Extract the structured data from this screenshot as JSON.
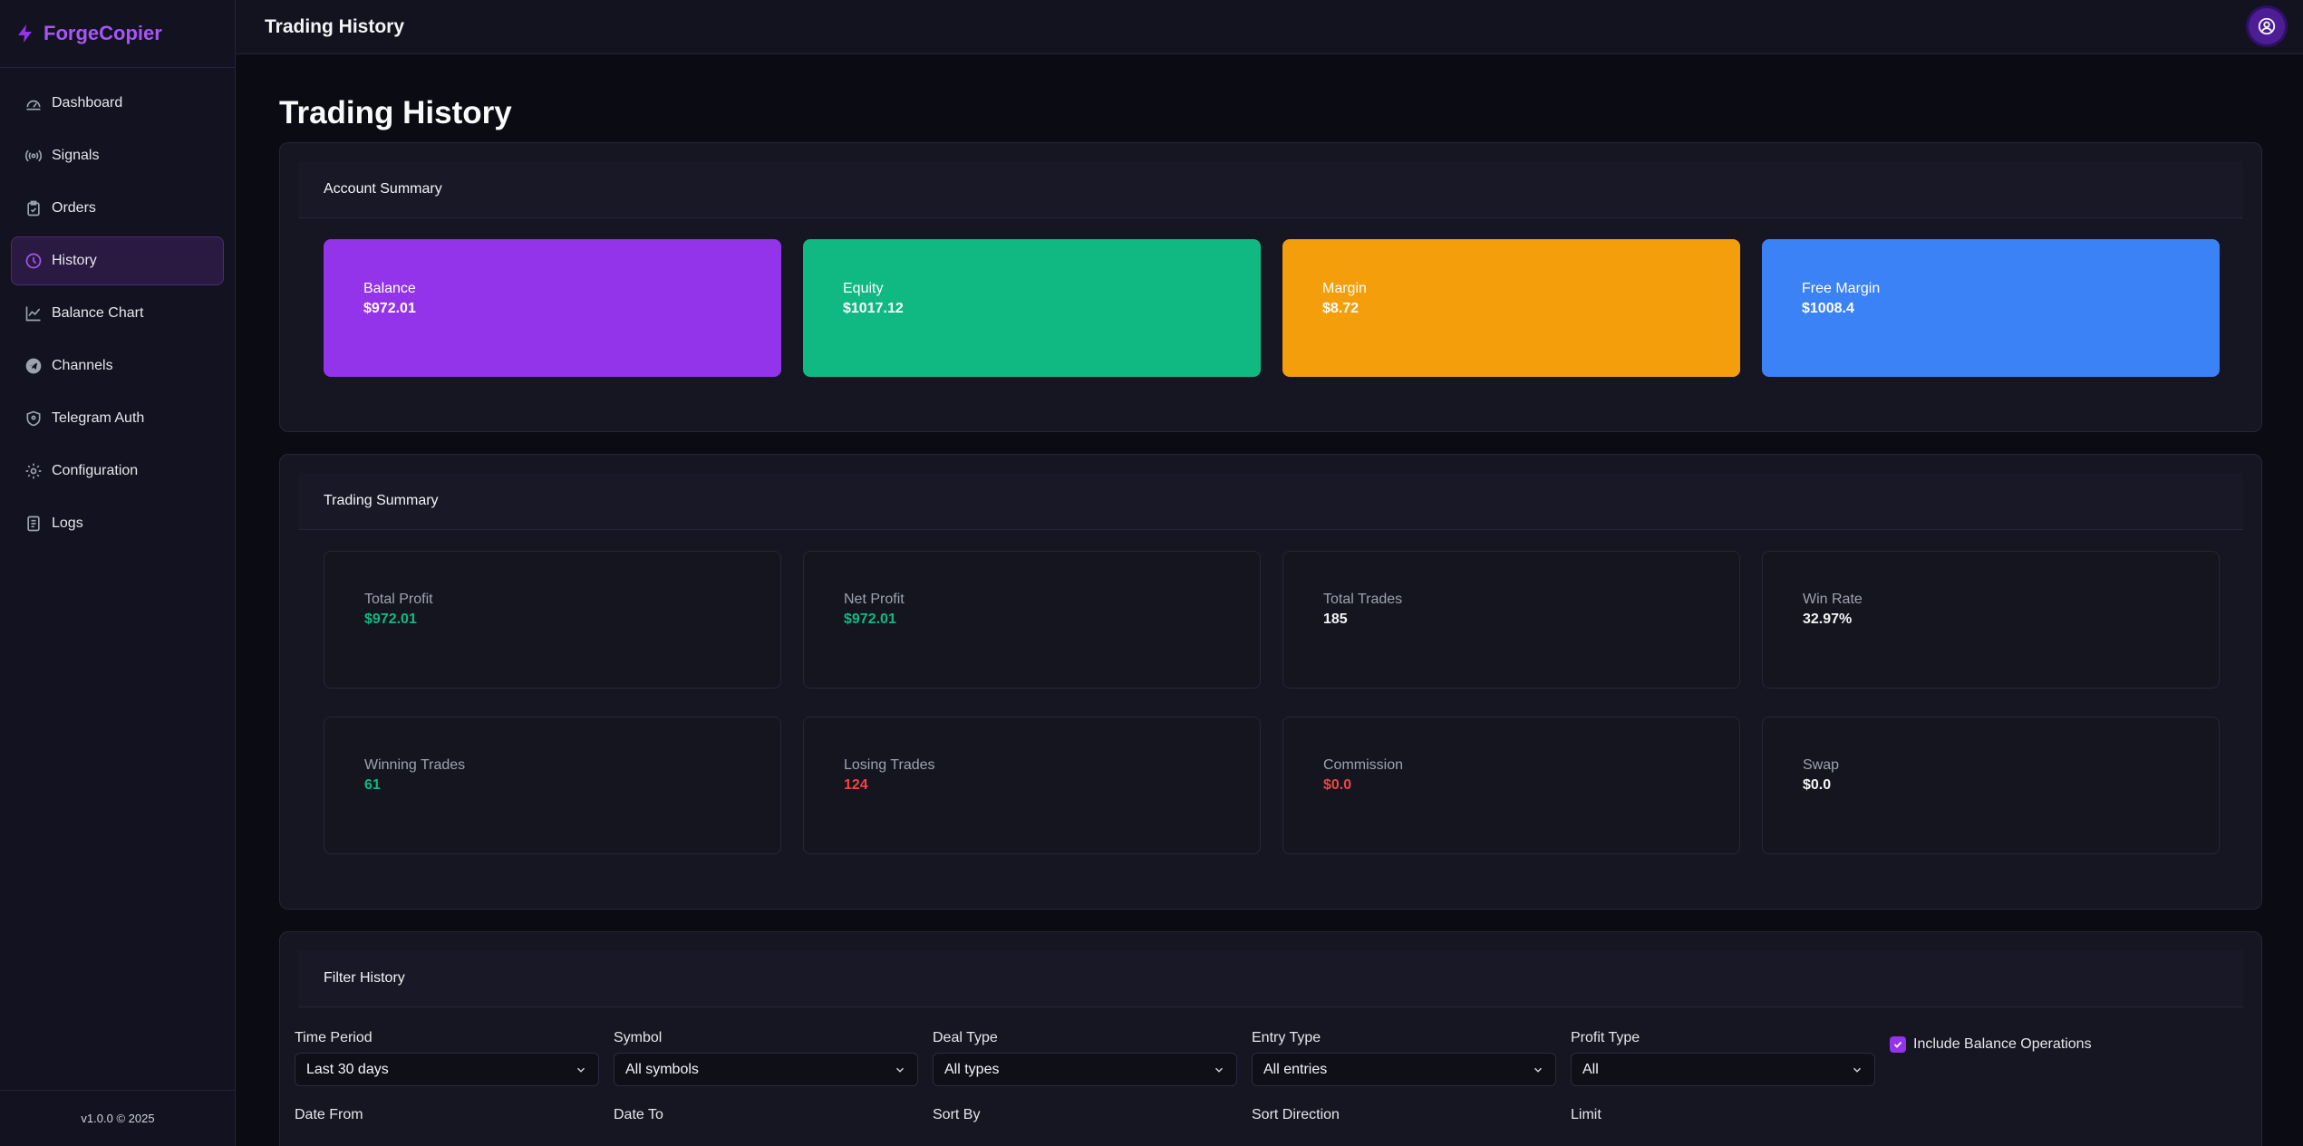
{
  "app": {
    "name": "ForgeCopier",
    "version": "v1.0.0 © 2025"
  },
  "sidebar": {
    "items": [
      {
        "label": "Dashboard",
        "icon": "gauge-icon"
      },
      {
        "label": "Signals",
        "icon": "broadcast-icon"
      },
      {
        "label": "Orders",
        "icon": "clipboard-icon"
      },
      {
        "label": "History",
        "icon": "clock-icon",
        "active": true
      },
      {
        "label": "Balance Chart",
        "icon": "line-chart-icon"
      },
      {
        "label": "Channels",
        "icon": "telegram-icon"
      },
      {
        "label": "Telegram Auth",
        "icon": "shield-icon"
      },
      {
        "label": "Configuration",
        "icon": "gear-icon"
      },
      {
        "label": "Logs",
        "icon": "document-icon"
      }
    ]
  },
  "header": {
    "title": "Trading History"
  },
  "page": {
    "title": "Trading History"
  },
  "account_summary": {
    "title": "Account Summary",
    "cards": [
      {
        "label": "Balance",
        "value": "$972.01",
        "color": "#9333ea"
      },
      {
        "label": "Equity",
        "value": "$1017.12",
        "color": "#10b981"
      },
      {
        "label": "Margin",
        "value": "$8.72",
        "color": "#f59e0b"
      },
      {
        "label": "Free Margin",
        "value": "$1008.4",
        "color": "#3b82f6"
      }
    ]
  },
  "trading_summary": {
    "title": "Trading Summary",
    "stats": [
      {
        "label": "Total Profit",
        "value": "$972.01",
        "tone": "green"
      },
      {
        "label": "Net Profit",
        "value": "$972.01",
        "tone": "green"
      },
      {
        "label": "Total Trades",
        "value": "185",
        "tone": "white"
      },
      {
        "label": "Win Rate",
        "value": "32.97%",
        "tone": "white"
      },
      {
        "label": "Winning Trades",
        "value": "61",
        "tone": "green"
      },
      {
        "label": "Losing Trades",
        "value": "124",
        "tone": "red"
      },
      {
        "label": "Commission",
        "value": "$0.0",
        "tone": "red"
      },
      {
        "label": "Swap",
        "value": "$0.0",
        "tone": "white"
      }
    ]
  },
  "filter": {
    "title": "Filter History",
    "row1": [
      {
        "label": "Time Period",
        "value": "Last 30 days"
      },
      {
        "label": "Symbol",
        "value": "All symbols"
      },
      {
        "label": "Deal Type",
        "value": "All types"
      },
      {
        "label": "Entry Type",
        "value": "All entries"
      },
      {
        "label": "Profit Type",
        "value": "All"
      }
    ],
    "include_balance": {
      "label": "Include Balance Operations",
      "checked": true
    },
    "row2": [
      {
        "label": "Date From"
      },
      {
        "label": "Date To"
      },
      {
        "label": "Sort By"
      },
      {
        "label": "Sort Direction"
      },
      {
        "label": "Limit"
      }
    ]
  },
  "colors": {
    "accent": "#9333ea",
    "profit": "#10b981",
    "loss": "#ef4444"
  }
}
